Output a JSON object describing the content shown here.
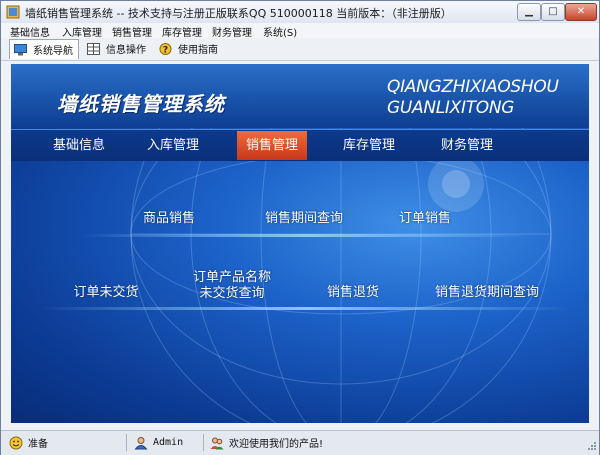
{
  "window": {
    "title": "墙纸销售管理系统 -- 技术支持与注册正版联系QQ 510000118   当前版本：（非注册版）",
    "minimize_glyph": "▁",
    "maximize_glyph": "□",
    "close_glyph": "✕"
  },
  "menu": [
    "基础信息",
    "入库管理",
    "销售管理",
    "库存管理",
    "财务管理",
    "系统(S)"
  ],
  "toolbar": {
    "nav_label": "系统导航",
    "info_label": "信息操作",
    "help_label": "使用指南"
  },
  "banner": {
    "title": "墙纸销售管理系统",
    "pinyin_line1": "QIANGZHIXIAOSHOU",
    "pinyin_line2": "GUANLIXITONG"
  },
  "nav": {
    "items": [
      "基础信息",
      "入库管理",
      "销售管理",
      "库存管理",
      "财务管理"
    ],
    "active_index": 2
  },
  "functions": {
    "row1": [
      "商品销售",
      "销售期间查询",
      "订单销售"
    ],
    "row2": [
      "订单未交货",
      "订单产品名称\n未交货查询",
      "销售退货",
      "销售退货期间查询"
    ]
  },
  "status": {
    "ready": "准备",
    "user": "Admin",
    "welcome": "欢迎使用我们的产品!"
  },
  "colors": {
    "accent_orange": "#e0522a",
    "banner_blue": "#1c62c9",
    "nav_dark": "#0a2f78"
  }
}
